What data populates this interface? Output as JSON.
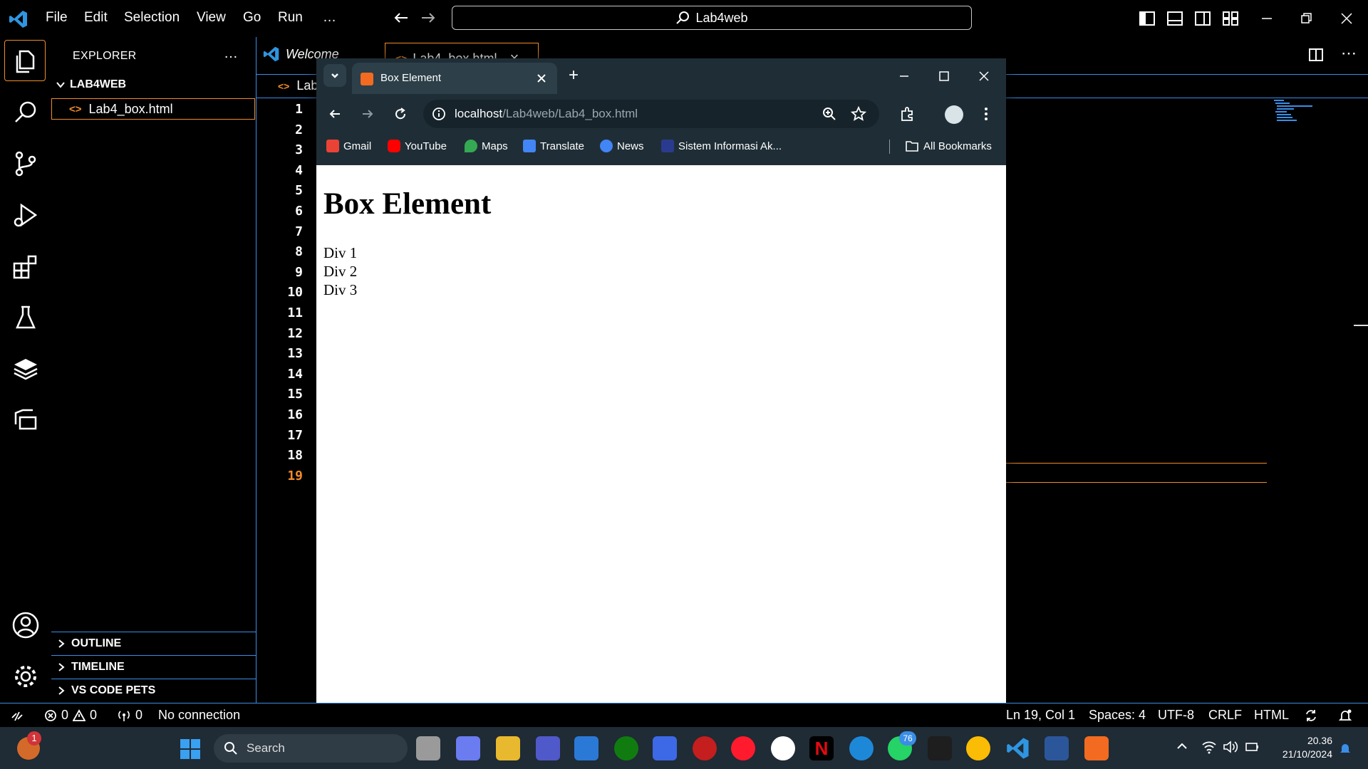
{
  "vscode": {
    "menu": [
      "File",
      "Edit",
      "Selection",
      "View",
      "Go",
      "Run",
      "…"
    ],
    "search_box": "Lab4web",
    "explorer": {
      "title": "EXPLORER",
      "more": "…",
      "folder": "LAB4WEB",
      "file": "Lab4_box.html",
      "sections": [
        "OUTLINE",
        "TIMELINE",
        "VS CODE PETS"
      ]
    },
    "tabs": [
      {
        "label": "Welcome"
      },
      {
        "label": "Lab4_box.html",
        "close": "×"
      }
    ],
    "breadcrumb": "Lab",
    "line_numbers": [
      "1",
      "2",
      "3",
      "4",
      "5",
      "6",
      "7",
      "8",
      "9",
      "10",
      "11",
      "12",
      "13",
      "14",
      "15",
      "16",
      "17",
      "18",
      "19"
    ],
    "current_line": "19",
    "status": {
      "errors": "0",
      "warnings": "0",
      "ports": "0",
      "connection": "No connection",
      "position": "Ln 19, Col 1",
      "spaces": "Spaces: 4",
      "encoding": "UTF-8",
      "eol": "CRLF",
      "language": "HTML"
    }
  },
  "browser": {
    "tab_title": "Box Element",
    "new_tab": "+",
    "address_host": "localhost",
    "address_path": "/Lab4web/Lab4_box.html",
    "bookmarks": [
      {
        "label": "Gmail",
        "color": "#ea4335"
      },
      {
        "label": "YouTube",
        "color": "#ff0000"
      },
      {
        "label": "Maps",
        "color": "#34a853"
      },
      {
        "label": "Translate",
        "color": "#4285f4"
      },
      {
        "label": "News",
        "color": "#4285f4"
      },
      {
        "label": "Sistem Informasi Ak...",
        "color": "#2a3b8f"
      }
    ],
    "all_bookmarks": "All Bookmarks",
    "page": {
      "heading": "Box Element",
      "divs": [
        "Div 1",
        "Div 2",
        "Div 3"
      ]
    }
  },
  "taskbar": {
    "search": "Search",
    "notification_count": "1",
    "badge_teams": "76",
    "time": "20.36",
    "date": "21/10/2024"
  },
  "colors": {
    "accent": "#3a8ee6",
    "current_line_number": "#f28c28",
    "chrome_frame": "#1f2e36"
  }
}
